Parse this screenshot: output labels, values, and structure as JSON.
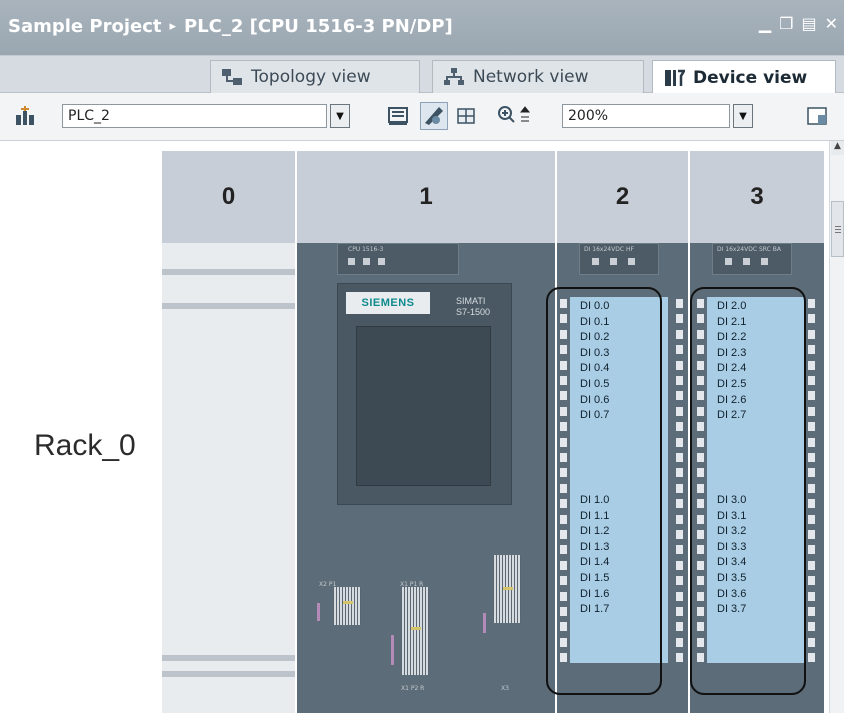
{
  "title": {
    "project": "Sample Project",
    "separator": "▸",
    "device": "PLC_2 [CPU 1516-3 PN/DP]"
  },
  "tabs": [
    {
      "label": "Topology view",
      "icon": "topology-icon",
      "active": false
    },
    {
      "label": "Network view",
      "icon": "network-icon",
      "active": false
    },
    {
      "label": "Device view",
      "icon": "device-icon",
      "active": true
    }
  ],
  "toolbar": {
    "device_select": "PLC_2",
    "zoom_value": "200%"
  },
  "rack": {
    "label": "Rack_0",
    "slots": [
      "0",
      "1",
      "2",
      "3"
    ]
  },
  "cpu": {
    "top_label": "CPU 1516-3",
    "brand": "SIEMENS",
    "series_line1": "SIMATI",
    "series_line2": "S7-1500",
    "port_label_1": "X2 P1",
    "port_label_2": "X1 P1 R",
    "port_label_3": "X1 P2 R",
    "port_label_4": "X3"
  },
  "modules": [
    {
      "slot": "2",
      "top_label": "DI 16x24VDC HF",
      "group1": [
        "DI 0.0",
        "DI 0.1",
        "DI 0.2",
        "DI 0.3",
        "DI 0.4",
        "DI 0.5",
        "DI 0.6",
        "DI 0.7"
      ],
      "group2": [
        "DI 1.0",
        "DI 1.1",
        "DI 1.2",
        "DI 1.3",
        "DI 1.4",
        "DI 1.5",
        "DI 1.6",
        "DI 1.7"
      ]
    },
    {
      "slot": "3",
      "top_label": "DI 16x24VDC SRC BA",
      "group1": [
        "DI 2.0",
        "DI 2.1",
        "DI 2.2",
        "DI 2.3",
        "DI 2.4",
        "DI 2.5",
        "DI 2.6",
        "DI 2.7"
      ],
      "group2": [
        "DI 3.0",
        "DI 3.1",
        "DI 3.2",
        "DI 3.3",
        "DI 3.4",
        "DI 3.5",
        "DI 3.6",
        "DI 3.7"
      ]
    }
  ],
  "colors": {
    "title_bg": "#9ea9b3",
    "di_channel_bg": "#a9cde4",
    "module_bg": "#5c6c78",
    "slot_header_bg": "#c7ced7"
  }
}
